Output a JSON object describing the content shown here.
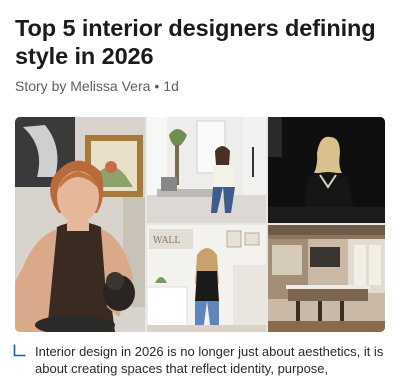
{
  "article": {
    "headline": "Top 5 interior designers defining style in 2026",
    "byline_author": "Story by Melissa Vera",
    "byline_separator": "•",
    "byline_age": "1d",
    "caption": "Interior design in 2026 is no longer just about aesthetics, it is about creating spaces that reflect identity, purpose,",
    "caption_icon": "corner-caption-icon"
  },
  "colors": {
    "accent": "#0067b8",
    "text": "#1b1b1b",
    "muted": "#5f5f5f"
  }
}
